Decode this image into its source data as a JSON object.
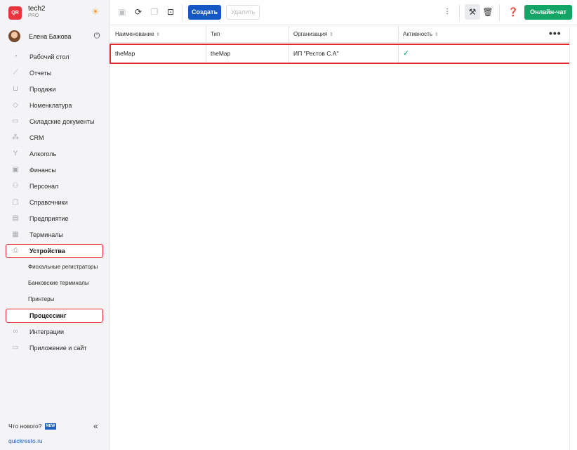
{
  "brand": {
    "logo_text": "QR",
    "name": "tech2",
    "plan": "PRO",
    "theme_icon": "sun-icon"
  },
  "user": {
    "name": "Елена Бажова",
    "power_icon": "power-icon"
  },
  "sidebar": {
    "items": [
      {
        "label": "Рабочий стол",
        "icon": "dashboard-icon"
      },
      {
        "label": "Отчеты",
        "icon": "chart-icon"
      },
      {
        "label": "Продажи",
        "icon": "basket-icon"
      },
      {
        "label": "Номенклатура",
        "icon": "tag-icon"
      },
      {
        "label": "Складские документы",
        "icon": "box-icon"
      },
      {
        "label": "CRM",
        "icon": "people-icon"
      },
      {
        "label": "Алкоголь",
        "icon": "cocktail-icon"
      },
      {
        "label": "Финансы",
        "icon": "wallet-icon"
      },
      {
        "label": "Персонал",
        "icon": "staff-icon"
      },
      {
        "label": "Справочники",
        "icon": "book-icon"
      },
      {
        "label": "Предприятие",
        "icon": "building-icon"
      },
      {
        "label": "Терминалы",
        "icon": "terminal-icon"
      },
      {
        "label": "Устройства",
        "icon": "printer-icon",
        "active": true
      }
    ],
    "sub_items": [
      {
        "label": "Фискальные регистраторы"
      },
      {
        "label": "Банковские терминалы"
      },
      {
        "label": "Принтеры"
      },
      {
        "label": "Процессинг",
        "active": true
      }
    ],
    "after_items": [
      {
        "label": "Интеграции",
        "icon": "link-icon"
      },
      {
        "label": "Приложение и сайт",
        "icon": "app-icon"
      }
    ],
    "whats_new": "Что нового?",
    "new_badge": "NEW",
    "site_link": "quickresto.ru"
  },
  "toolbar": {
    "create_label": "Создать",
    "delete_label": "Удалить",
    "chat_label": "Онлайн-чат"
  },
  "table": {
    "columns": [
      "Наименование",
      "Тип",
      "Организация",
      "Активность"
    ],
    "rows": [
      {
        "name": "theMap",
        "type": "theMap",
        "org": "ИП \"Рестов С.А\"",
        "active": "✓"
      }
    ]
  },
  "colors": {
    "accent": "#1458c4",
    "chat": "#12a566",
    "highlight": "#e0282e"
  }
}
